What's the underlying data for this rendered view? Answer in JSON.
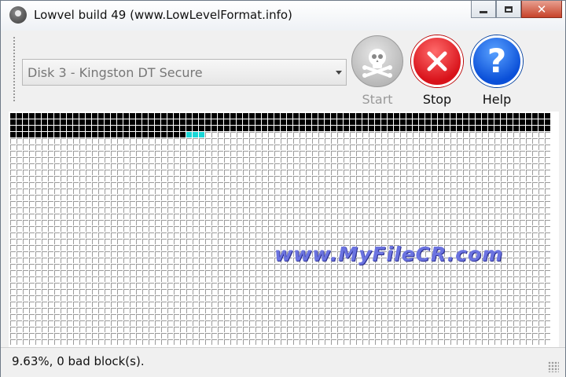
{
  "window": {
    "title": "Lowvel build 49 (www.LowLevelFormat.info)",
    "icon": "app-icon",
    "controls": [
      "minimize-icon",
      "maximize-icon",
      "close-icon"
    ]
  },
  "toolbar": {
    "disk_select_value": "Disk 3 - Kingston DT Secure",
    "start_label": "Start",
    "stop_label": "Stop",
    "help_label": "Help",
    "start_icon": "skull-crossbones-icon",
    "stop_icon": "x-icon",
    "help_icon": "question-icon",
    "help_glyph": "?",
    "stop_color": "#d8121a",
    "help_color": "#0a4fd8"
  },
  "blocks": {
    "total_rows": 38,
    "total_cols": 86,
    "written_blocks": 286,
    "cursor_blocks": 3,
    "written_color": "#000000",
    "cursor_color": "#19d6d6",
    "empty_color": "#9b9b9b"
  },
  "status": {
    "text": "9.63%, 0 bad block(s).",
    "progress_percent": 9.63,
    "bad_blocks": 0
  },
  "watermark": {
    "text": "www.MyFileCR.com"
  }
}
